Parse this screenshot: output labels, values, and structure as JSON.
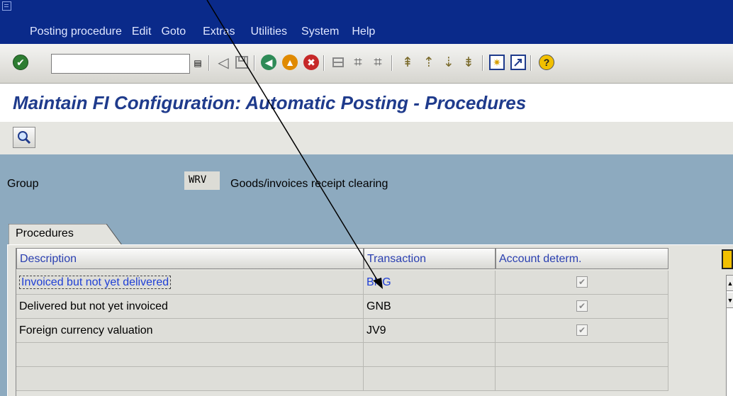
{
  "menubar": {
    "items": [
      {
        "label": "Posting procedure"
      },
      {
        "label": "Edit"
      },
      {
        "label": "Goto"
      },
      {
        "label": "Extras"
      },
      {
        "label": "Utilities"
      },
      {
        "label": "System"
      },
      {
        "label": "Help"
      }
    ]
  },
  "toolbar": {
    "command_field_value": "",
    "icons": [
      "enter-check-icon",
      "save-icon",
      "back-icon",
      "exit-icon",
      "cancel-icon",
      "print-icon",
      "find-icon",
      "find-next-icon",
      "first-page-icon",
      "previous-page-icon",
      "next-page-icon",
      "last-page-icon",
      "new-session-icon",
      "shortcut-icon",
      "help-icon"
    ]
  },
  "page": {
    "title": "Maintain FI Configuration: Automatic Posting - Procedures"
  },
  "header": {
    "group_label": "Group",
    "group_value": "WRV",
    "group_description": "Goods/invoices receipt clearing"
  },
  "tab": {
    "label": "Procedures"
  },
  "table": {
    "columns": [
      "Description",
      "Transaction",
      "Account determ."
    ],
    "rows": [
      {
        "description": "Invoiced but not yet delivered",
        "transaction": "BNG",
        "account_determ": true
      },
      {
        "description": "Delivered but not yet invoiced",
        "transaction": "GNB",
        "account_determ": true
      },
      {
        "description": "Foreign currency valuation",
        "transaction": "JV9",
        "account_determ": true
      },
      {
        "description": "",
        "transaction": "",
        "account_determ": null
      },
      {
        "description": "",
        "transaction": "",
        "account_determ": null
      }
    ]
  },
  "colors": {
    "menubar_bg": "#0a2a8a",
    "title_color": "#1f3b8c",
    "header_area_bg": "#8daabf",
    "selected_text": "#1f3fd6"
  }
}
